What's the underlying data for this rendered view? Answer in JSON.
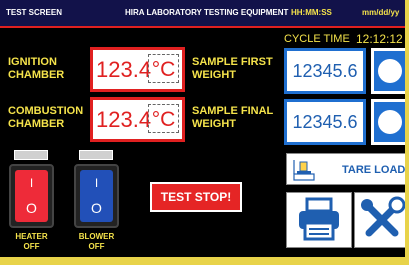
{
  "topbar": {
    "title": "TEST SCREEN",
    "company": "HIRA LABORATORY TESTING EQUIPMENT",
    "time_format": "HH:MM:SS",
    "date_format": "mm/dd/yy"
  },
  "cycle": {
    "label": "CYCLE TIME",
    "value": "12:12:12"
  },
  "ignition": {
    "label": "IGNITION\nCHAMBER",
    "value": "123.4",
    "unit": "°C"
  },
  "combustion": {
    "label": "COMBUSTION\nCHAMBER",
    "value": "123.4",
    "unit": "°C"
  },
  "sample_first": {
    "label": "SAMPLE FIRST\nWEIGHT",
    "value": "12345.6"
  },
  "sample_final": {
    "label": "SAMPLE FINAL\nWEIGHT",
    "value": "12345.6"
  },
  "heater": {
    "on": "I",
    "off": "O",
    "label": "HEATER\nOFF"
  },
  "blower": {
    "on": "I",
    "off": "O",
    "label": "BLOWER\nOFF"
  },
  "stop_label": "TEST STOP!",
  "tare_label": "TARE LOAD",
  "colors": {
    "panel_bg": "#000000",
    "label_yellow": "#f5e34b",
    "temp_red": "#e02020",
    "weight_blue": "#1f6fd0",
    "heater_red": "#ee2b39",
    "blower_blue": "#2250b8"
  }
}
